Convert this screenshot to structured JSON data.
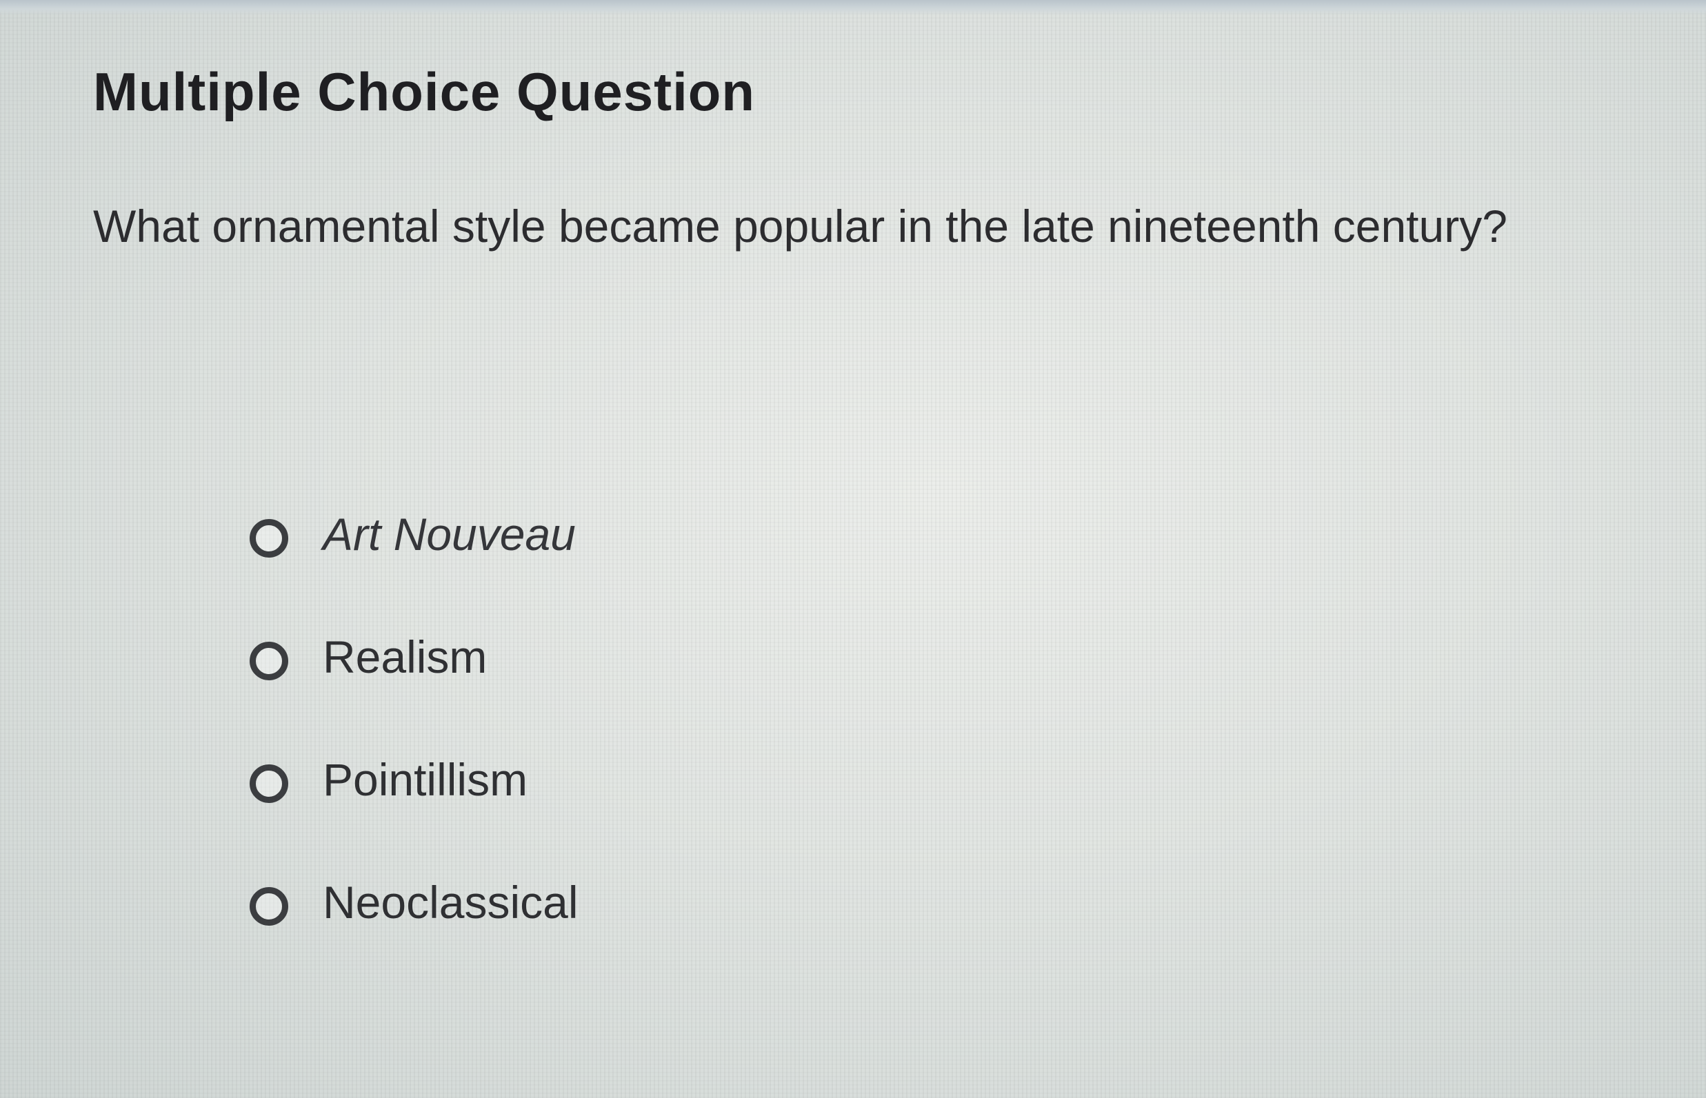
{
  "page": {
    "title": "Multiple Choice Question"
  },
  "question": {
    "text": "What ornamental style became popular in the late nineteenth century?"
  },
  "choices": [
    {
      "label": "Art Nouveau",
      "selected": false
    },
    {
      "label": "Realism",
      "selected": false
    },
    {
      "label": "Pointillism",
      "selected": false
    },
    {
      "label": "Neoclassical",
      "selected": false
    }
  ]
}
